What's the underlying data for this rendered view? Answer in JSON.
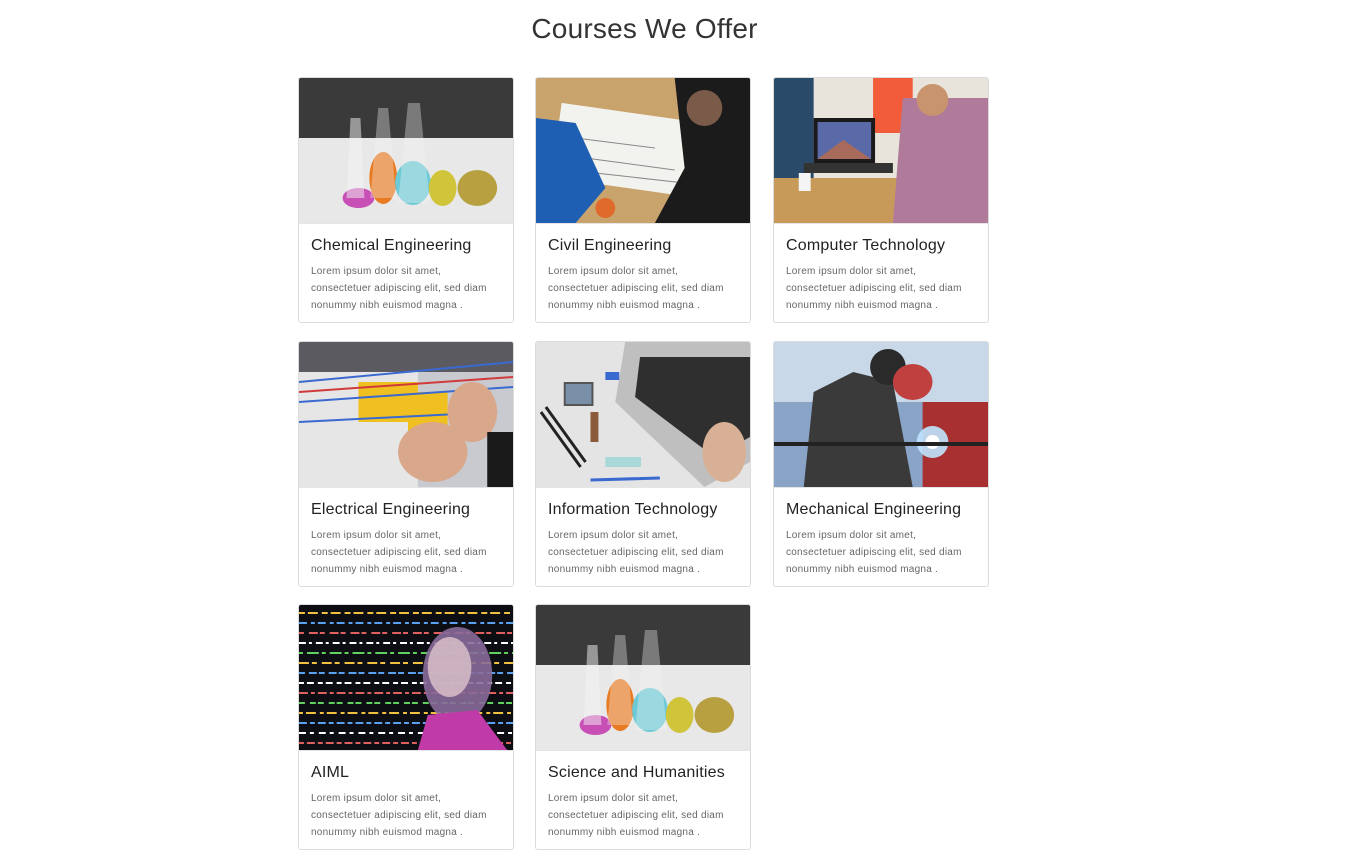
{
  "page": {
    "title": "Courses We Offer"
  },
  "courses": [
    {
      "title": "Chemical Engineering",
      "description": "Lorem ipsum dolor sit amet, consectetuer adipiscing elit, sed diam nonummy nibh euismod magna .",
      "image": "lab-flasks-photo"
    },
    {
      "title": "Civil Engineering",
      "description": "Lorem ipsum dolor sit amet, consectetuer adipiscing elit, sed diam nonummy nibh euismod magna .",
      "image": "blueprint-photo"
    },
    {
      "title": "Computer Technology",
      "description": "Lorem ipsum dolor sit amet, consectetuer adipiscing elit, sed diam nonummy nibh euismod magna .",
      "image": "laptop-desk-photo"
    },
    {
      "title": "Electrical Engineering",
      "description": "Lorem ipsum dolor sit amet, consectetuer adipiscing elit, sed diam nonummy nibh euismod magna .",
      "image": "wiring-panel-photo"
    },
    {
      "title": "Information Technology",
      "description": "Lorem ipsum dolor sit amet, consectetuer adipiscing elit, sed diam nonummy nibh euismod magna .",
      "image": "laptop-keyboard-photo"
    },
    {
      "title": "Mechanical Engineering",
      "description": "Lorem ipsum dolor sit amet, consectetuer adipiscing elit, sed diam nonummy nibh euismod magna .",
      "image": "welder-photo"
    },
    {
      "title": "AIML",
      "description": "Lorem ipsum dolor sit amet, consectetuer adipiscing elit, sed diam nonummy nibh euismod magna .",
      "image": "ai-face-code-photo"
    },
    {
      "title": "Science and Humanities",
      "description": "Lorem ipsum dolor sit amet, consectetuer adipiscing elit, sed diam nonummy nibh euismod magna .",
      "image": "lab-flasks-photo"
    }
  ]
}
